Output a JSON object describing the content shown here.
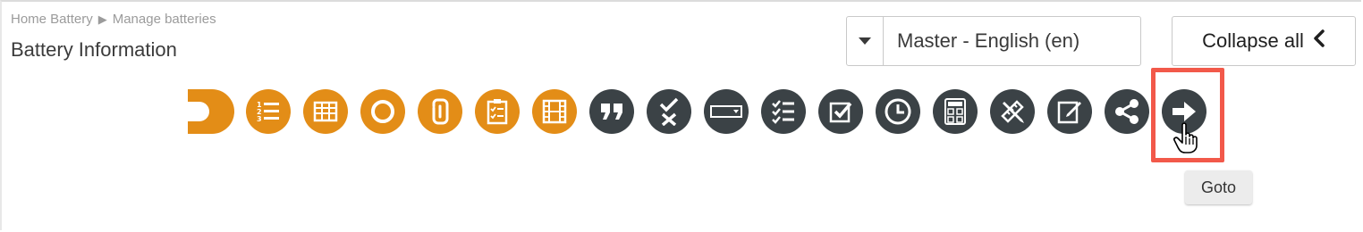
{
  "breadcrumb": {
    "items": [
      "Home Battery",
      "Manage batteries"
    ],
    "separator": "▶"
  },
  "page_title": "Battery Information",
  "language_select": {
    "value": "Master - English (en)"
  },
  "collapse_button": {
    "label": "Collapse all"
  },
  "colors": {
    "orange": "#e38d17",
    "dark": "#3b4246",
    "highlight": "#f2594a"
  },
  "toolbar": {
    "orange_tools": [
      "partial-circle-icon",
      "numbered-list-icon",
      "grid-table-icon",
      "circle-icon",
      "attachment-loop-icon",
      "clipboard-checklist-icon",
      "film-strip-icon"
    ],
    "dark_tools": [
      "quote-icon",
      "check-cross-icon",
      "dropdown-field-icon",
      "checklist-icon",
      "checkbox-icon",
      "clock-icon",
      "calculator-icon",
      "ruler-pencil-icon",
      "edit-note-icon",
      "share-icon",
      "arrow-right-icon"
    ]
  },
  "tooltip": {
    "text": "Goto"
  }
}
